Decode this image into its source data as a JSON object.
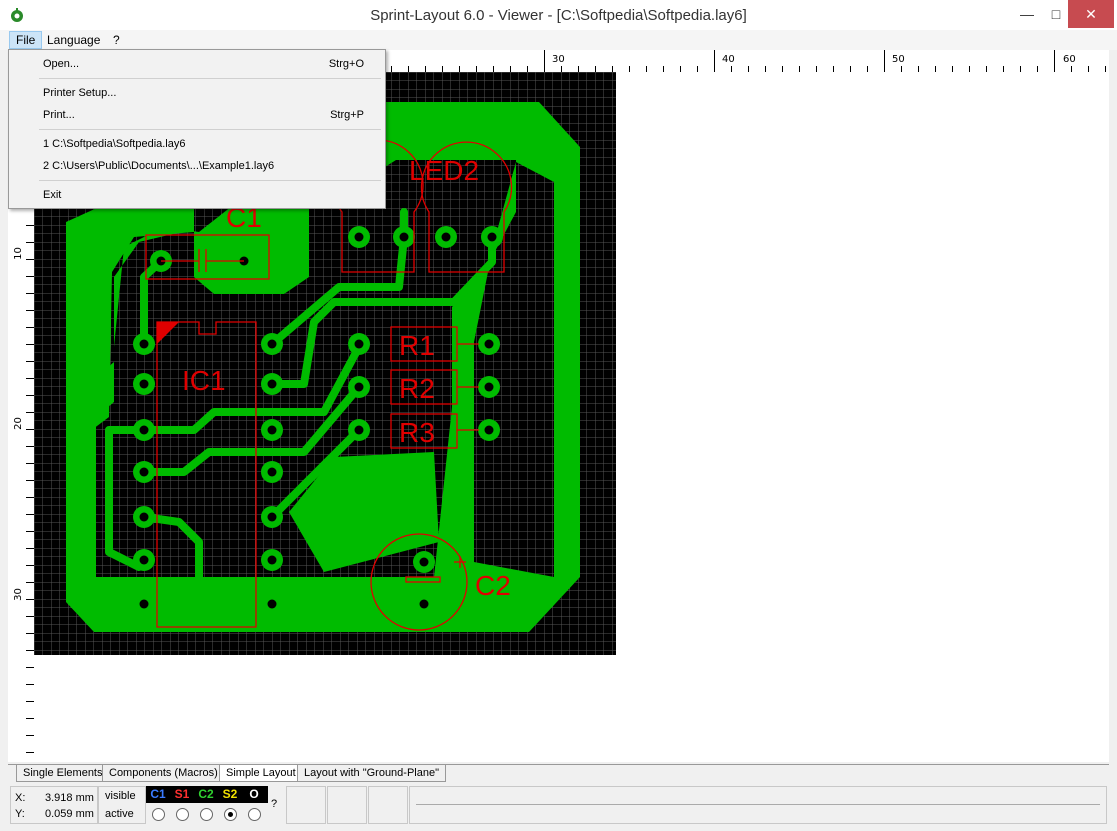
{
  "window": {
    "title": "Sprint-Layout 6.0 - Viewer - [C:\\Softpedia\\Softpedia.lay6]"
  },
  "menubar": {
    "file": "File",
    "language": "Language",
    "help": "?"
  },
  "file_menu": {
    "items": [
      {
        "label": "Open...",
        "shortcut": "Strg+O"
      },
      {
        "label": "Printer Setup...",
        "shortcut": ""
      },
      {
        "label": "Print...",
        "shortcut": "Strg+P"
      },
      {
        "label": "1 C:\\Softpedia\\Softpedia.lay6",
        "shortcut": ""
      },
      {
        "label": "2 C:\\Users\\Public\\Documents\\...\\Example1.lay6",
        "shortcut": ""
      },
      {
        "label": "Exit",
        "shortcut": ""
      }
    ]
  },
  "ruler": {
    "h_labels": [
      "30",
      "40",
      "50",
      "60"
    ],
    "v_labels": [
      "10",
      "20",
      "30"
    ]
  },
  "board": {
    "labels": {
      "c1": "C1",
      "led2": "LED2",
      "ic1": "IC1",
      "r1": "R1",
      "r2": "R2",
      "r3": "R3",
      "c2": "C2"
    },
    "colors": {
      "board": "#000000",
      "grid": "#505050",
      "copper": "#00bb00",
      "silk": "#e00000",
      "pad_hole": "#000000"
    }
  },
  "tabs": [
    "Single Elements",
    "Components (Macros)",
    "Simple Layout",
    "Layout with \"Ground-Plane\""
  ],
  "status": {
    "x_label": "X:",
    "x_value": "3.918 mm",
    "y_label": "Y:",
    "y_value": "0.059 mm",
    "visible_label": "visible",
    "active_label": "active",
    "layers": [
      {
        "name": "C1",
        "color": "#3a7bff"
      },
      {
        "name": "S1",
        "color": "#ff3030"
      },
      {
        "name": "C2",
        "color": "#30d030"
      },
      {
        "name": "S2",
        "color": "#f0e000"
      },
      {
        "name": "O",
        "color": "#ffffff"
      }
    ],
    "help": "?"
  }
}
